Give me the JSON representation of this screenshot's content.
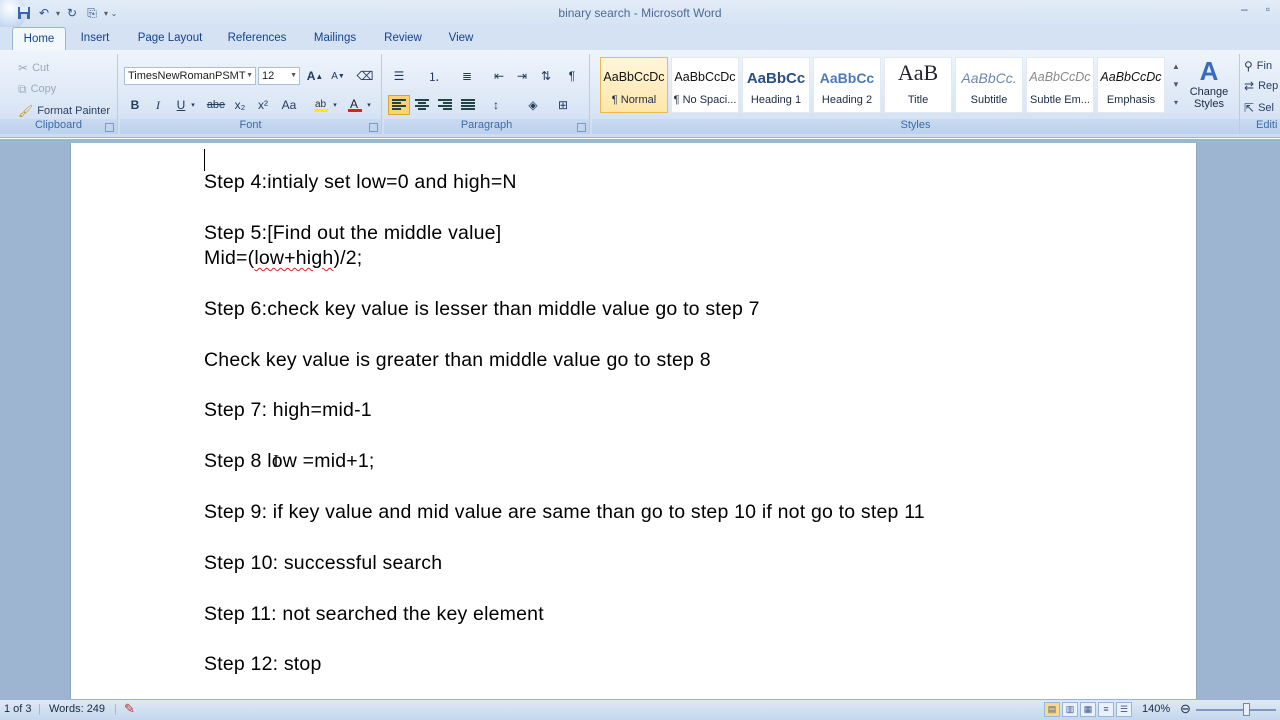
{
  "window": {
    "title": "binary search - Microsoft Word",
    "controls": [
      "–",
      "▫"
    ]
  },
  "quick_access": [
    {
      "name": "save-icon",
      "glyph": "💾"
    },
    {
      "name": "undo-icon",
      "glyph": "↶"
    },
    {
      "name": "redo-icon",
      "glyph": "↻"
    },
    {
      "name": "page-icon",
      "glyph": "⎘"
    }
  ],
  "tabs": [
    "Home",
    "Insert",
    "Page Layout",
    "References",
    "Mailings",
    "Review",
    "View"
  ],
  "clipboard": {
    "cut": "Cut",
    "copy": "Copy",
    "format_painter": "Format Painter",
    "label": "Clipboard"
  },
  "font": {
    "name": "TimesNewRomanPSMT",
    "size": "12",
    "label": "Font",
    "buttons": [
      "B",
      "I",
      "U",
      "abe",
      "x₂",
      "x²",
      "Aa"
    ]
  },
  "paragraph": {
    "label": "Paragraph"
  },
  "styles": {
    "label": "Styles",
    "items": [
      {
        "preview": "AaBbCcDc",
        "name": "¶ Normal",
        "selected": true
      },
      {
        "preview": "AaBbCcDc",
        "name": "¶ No Spaci...",
        "selected": false
      },
      {
        "preview": "AaBbCc",
        "name": "Heading 1",
        "selected": false
      },
      {
        "preview": "AaBbCc",
        "name": "Heading 2",
        "selected": false
      },
      {
        "preview": "AaB",
        "name": "Title",
        "selected": false
      },
      {
        "preview": "AaBbCc.",
        "name": "Subtitle",
        "selected": false
      },
      {
        "preview": "AaBbCcDc",
        "name": "Subtle Em...",
        "selected": false
      },
      {
        "preview": "AaBbCcDc",
        "name": "Emphasis",
        "selected": false
      }
    ],
    "change_styles": "Change Styles"
  },
  "editing": {
    "label": "Editi",
    "find": "Fin",
    "replace": "Rep",
    "select": "Sel"
  },
  "document": {
    "lines": [
      "Step 4:intialy set low=0 and high=N",
      "Step 5:[Find out the middle value]",
      "Check key value is greater than middle value go to step 8",
      "Step 7: high=mid-1",
      "Step 8 low =mid+1;",
      "Step 9: if key value and mid value are same than go to step 10 if not go to step 11",
      "Step 10: successful search",
      "Step 11: not searched the key element",
      "Step 12: stop"
    ],
    "mid_prefix": "Mid=(",
    "mid_word": "low+high",
    "mid_suffix": ")/2;",
    "step6_prefix": "Step 6:check key value is ",
    "step6_word": "lesser",
    "step6_suffix": " than middle value go to step 7"
  },
  "status": {
    "page": "1 of 3",
    "words": "Words: 249",
    "zoom": "140%"
  }
}
